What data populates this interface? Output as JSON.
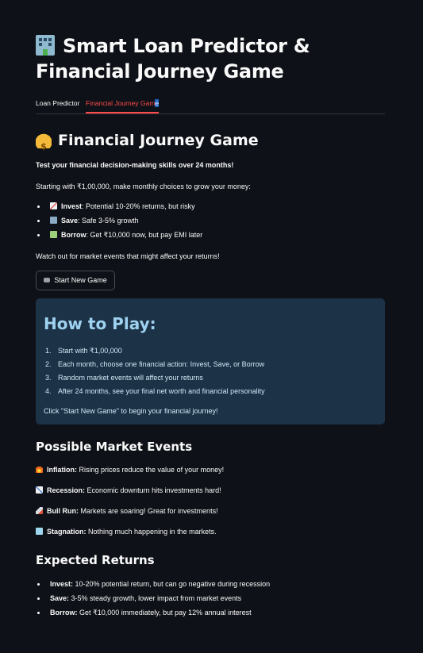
{
  "app": {
    "title": "Smart Loan Predictor & Financial Journey Game",
    "title_icon": "office-building-icon"
  },
  "tabs": [
    {
      "label": "Loan Predictor",
      "active": false
    },
    {
      "label": "Financial Journey Game",
      "active": true
    }
  ],
  "game": {
    "heading": "Financial Journey Game",
    "heading_icon": "money-bag-icon",
    "intro_bold": "Test your financial decision-making skills over 24 months!",
    "intro": "Starting with ₹1,00,000, make monthly choices to grow your money:",
    "options": [
      {
        "icon": "chart-increasing-icon",
        "name": "Invest",
        "desc": ": Potential 10-20% returns, but risky"
      },
      {
        "icon": "bank-icon",
        "name": "Save",
        "desc": ": Safe 3-5% growth"
      },
      {
        "icon": "money-with-wings-icon",
        "name": "Borrow",
        "desc": ": Get ₹10,000 now, but pay EMI later"
      }
    ],
    "warning": "Watch out for market events that might affect your returns!",
    "start_button": "Start New Game",
    "start_button_icon": "game-controller-icon"
  },
  "how_to_play": {
    "title": "How to Play:",
    "steps": [
      "Start with ₹1,00,000",
      "Each month, choose one financial action: Invest, Save, or Borrow",
      "Random market events will affect your returns",
      "After 24 months, see your final net worth and financial personality"
    ],
    "footer": "Click \"Start New Game\" to begin your financial journey!"
  },
  "market_events": {
    "title": "Possible Market Events",
    "events": [
      {
        "icon": "fire-icon",
        "name": "Inflation:",
        "desc": " Rising prices reduce the value of your money!"
      },
      {
        "icon": "chart-decreasing-icon",
        "name": "Recession:",
        "desc": " Economic downturn hits investments hard!"
      },
      {
        "icon": "rocket-icon",
        "name": "Bull Run:",
        "desc": " Markets are soaring! Great for investments!"
      },
      {
        "icon": "ice-cube-icon",
        "name": "Stagnation:",
        "desc": " Nothing much happening in the markets."
      }
    ]
  },
  "expected_returns": {
    "title": "Expected Returns",
    "items": [
      {
        "name": "Invest:",
        "desc": " 10-20% potential return, but can go negative during recession"
      },
      {
        "name": "Save:",
        "desc": " 3-5% steady growth, lower impact from market events"
      },
      {
        "name": "Borrow:",
        "desc": " Get ₹10,000 immediately, but pay 12% annual interest"
      }
    ]
  },
  "colors": {
    "background": "#0e1117",
    "accent": "#ff4b4b",
    "info_box": "#1c3246",
    "info_title": "#9fd2f0"
  }
}
